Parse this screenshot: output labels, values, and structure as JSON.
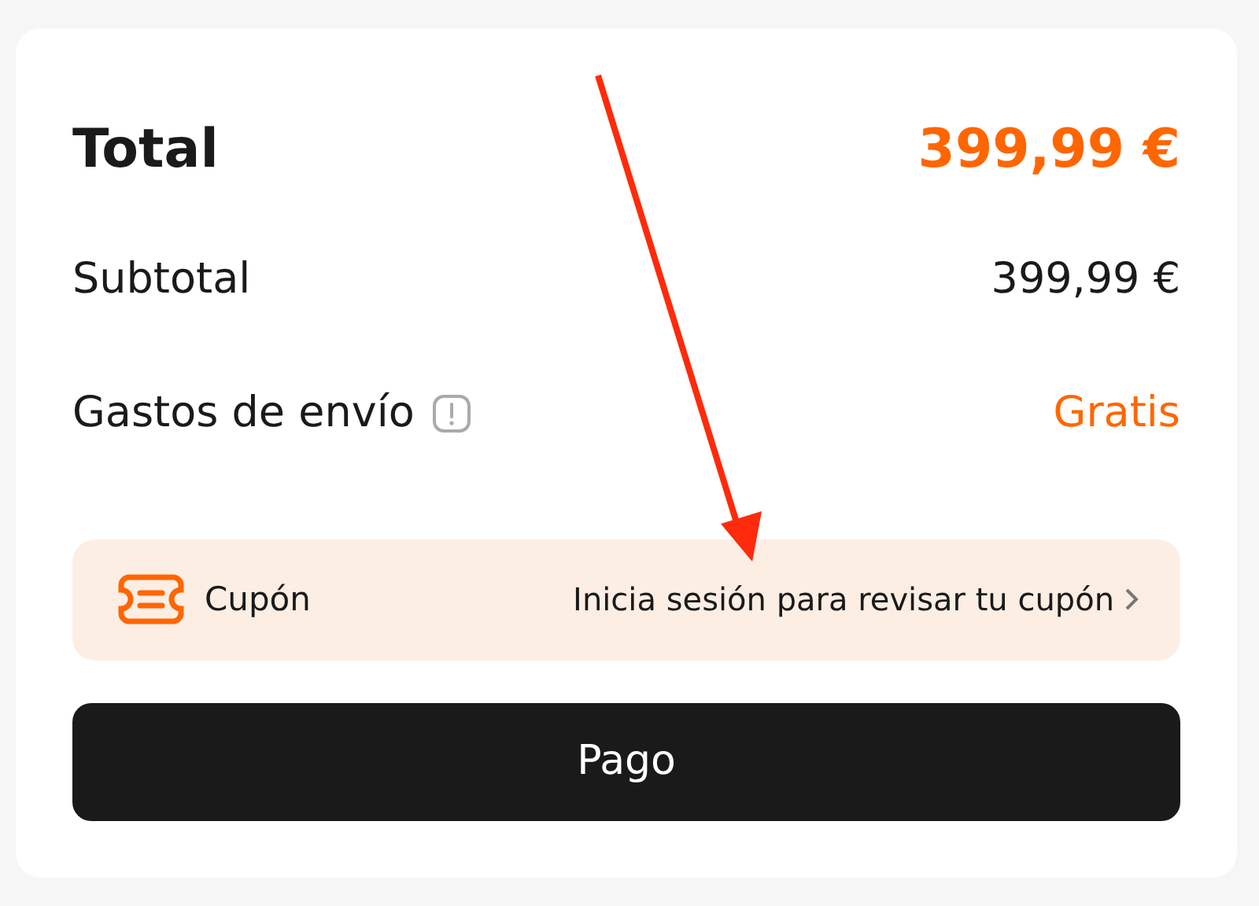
{
  "total": {
    "label": "Total",
    "value": "399,99 €"
  },
  "rows": [
    {
      "label": "Subtotal",
      "value": "399,99 €",
      "kind": "plain"
    },
    {
      "label": "Gastos de envío",
      "value": "Gratis",
      "kind": "info"
    }
  ],
  "coupon": {
    "label": "Cupón",
    "action": "Inicia sesión para revisar tu cupón"
  },
  "pay_button": "Pago",
  "annotation": {
    "kind": "arrow"
  }
}
